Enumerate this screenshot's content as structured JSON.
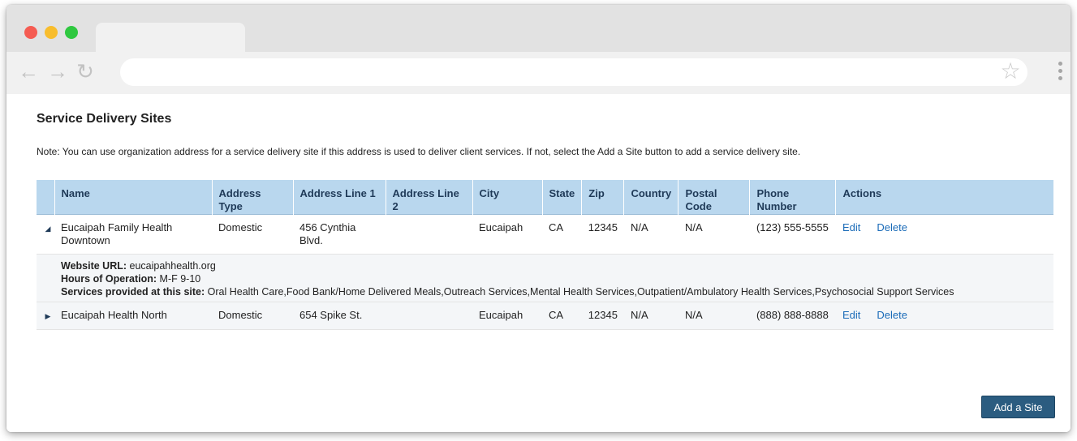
{
  "browser": {
    "icons": {
      "back": "back-arrow-icon",
      "forward": "forward-arrow-icon",
      "reload": "reload-icon",
      "bookmark": "star-icon",
      "menu": "kebab-menu-icon"
    },
    "colors": {
      "close": "#f55c52",
      "minimize": "#f8bd2d",
      "maximize": "#2fc840"
    }
  },
  "page": {
    "title": "Service Delivery Sites",
    "note": "Note: You can use organization address for a service delivery site if this address is used to deliver client services. If not, select the Add a Site button to add a service delivery site."
  },
  "table": {
    "headers": {
      "name": "Name",
      "address_type": "Address Type",
      "address_line_1": "Address Line 1",
      "address_line_2": "Address Line 2",
      "city": "City",
      "state": "State",
      "zip": "Zip",
      "country": "Country",
      "postal_code": "Postal Code",
      "phone": "Phone Number",
      "actions": "Actions"
    },
    "rows": [
      {
        "name": "Eucaipah Family Health Downtown",
        "address_type": "Domestic",
        "address_line_1": "456 Cynthia Blvd.",
        "address_line_2": "",
        "city": "Eucaipah",
        "state": "CA",
        "zip": "12345",
        "country": "N/A",
        "postal_code": "N/A",
        "phone": "(123) 555-5555",
        "edit": "Edit",
        "delete": "Delete",
        "expanded": true,
        "details": {
          "website_label": "Website URL:",
          "website_value": "eucaipahhealth.org",
          "hours_label": "Hours of Operation:",
          "hours_value": "M-F 9-10",
          "services_label": "Services provided at this site:",
          "services_value": "Oral Health Care,Food Bank/Home Delivered Meals,Outreach Services,Mental Health Services,Outpatient/Ambulatory Health Services,Psychosocial Support Services"
        }
      },
      {
        "name": "Eucaipah Health North",
        "address_type": "Domestic",
        "address_line_1": "654 Spike St.",
        "address_line_2": "",
        "city": "Eucaipah",
        "state": "CA",
        "zip": "12345",
        "country": "N/A",
        "postal_code": "N/A",
        "phone": "(888) 888-8888",
        "edit": "Edit",
        "delete": "Delete",
        "expanded": false
      }
    ]
  },
  "buttons": {
    "add_site": "Add a Site"
  }
}
